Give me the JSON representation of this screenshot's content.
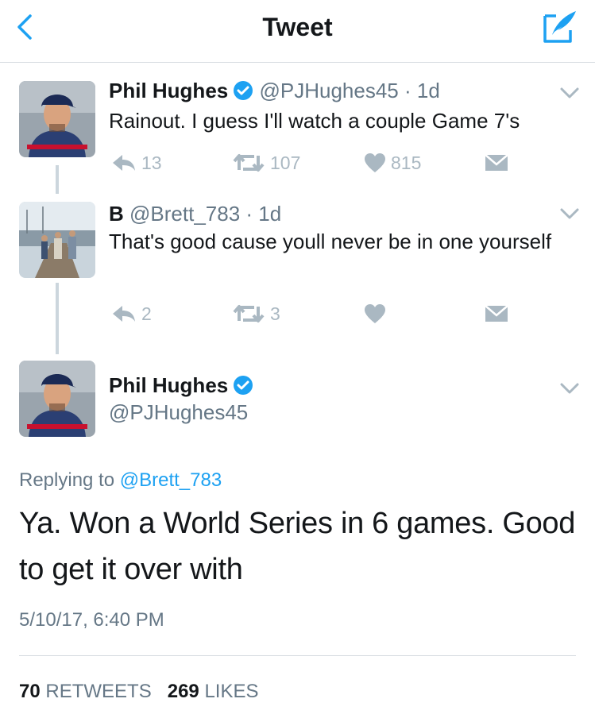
{
  "nav": {
    "title": "Tweet"
  },
  "tweets": [
    {
      "name": "Phil Hughes",
      "handle": "@PJHughes45",
      "time": "· 1d",
      "text": "Rainout. I guess I'll watch a couple Game 7's",
      "replies": "13",
      "retweets": "107",
      "likes": "815"
    },
    {
      "name": "B",
      "handle": "@Brett_783",
      "time": "· 1d",
      "text": "That's good cause youll never be in one yourself",
      "replies": "2",
      "retweets": "3",
      "likes": ""
    }
  ],
  "main": {
    "name": "Phil Hughes",
    "handle": "@PJHughes45",
    "replying_prefix": "Replying to",
    "replying_to": "@Brett_783",
    "text": "Ya. Won a World Series in 6 games. Good to get it over with",
    "timestamp": "5/10/17, 6:40 PM",
    "retweets_count": "70",
    "retweets_label": "RETWEETS",
    "likes_count": "269",
    "likes_label": "LIKES"
  },
  "colors": {
    "accent": "#1da1f2",
    "icon": "#aab8c2",
    "secondary": "#657786",
    "line": "#ccd6dd"
  },
  "icons": [
    "back-chevron-icon",
    "compose-icon",
    "verified-badge-icon",
    "reply-icon",
    "retweet-icon",
    "heart-icon",
    "dm-envelope-icon",
    "chevron-down-icon"
  ]
}
